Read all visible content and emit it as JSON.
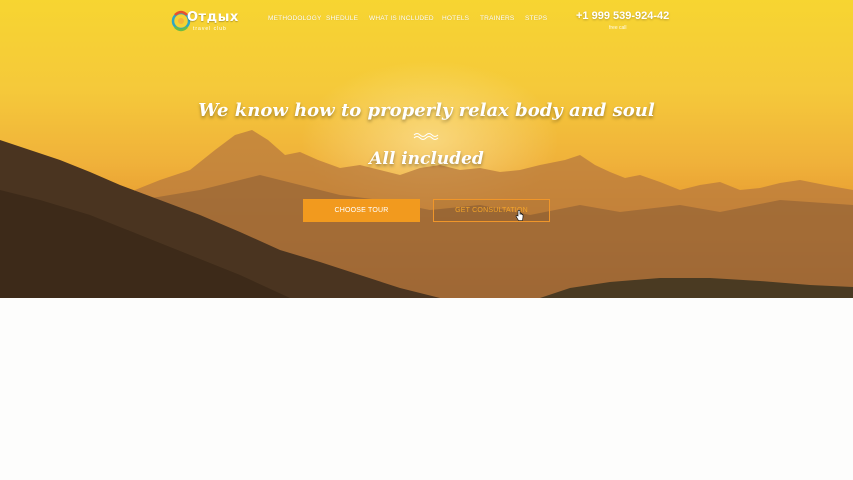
{
  "brand": {
    "logo_text": "Отдых",
    "logo_subtext": "travel club"
  },
  "nav": {
    "items": [
      {
        "label": "Methodology"
      },
      {
        "label": "Shedule"
      },
      {
        "label": "What is included"
      },
      {
        "label": "Hotels"
      },
      {
        "label": "Trainers"
      },
      {
        "label": "Steps"
      }
    ]
  },
  "contact": {
    "phone": "+1 999 539-924-42",
    "phone_note": "free call"
  },
  "hero": {
    "headline": "We know how to properly relax body and soul",
    "subheadline": "All included",
    "primary_button": "Choose tour",
    "secondary_button": "Get consultation"
  },
  "colors": {
    "accent": "#f29a1e",
    "sky_top": "#f7d531",
    "background": "#fdfdfc"
  },
  "icons": {
    "logo": "sun-circle-logo-icon",
    "divider": "wave-divider-icon",
    "cursor": "hand-pointer-icon"
  }
}
